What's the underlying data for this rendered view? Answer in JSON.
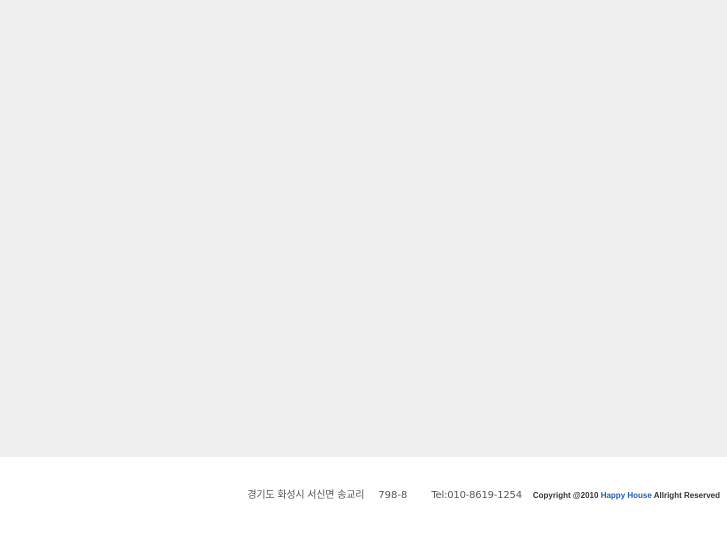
{
  "footer": {
    "address": "경기도 화성시 서신면 송교리",
    "address_number": "798-8",
    "tel": "Tel:010-8619-1254",
    "copyright_prefix": "Copyright @2010",
    "brand": "Happy House",
    "copyright_suffix": "Allright Reserved",
    "brand_color": "#1f5fb0"
  }
}
